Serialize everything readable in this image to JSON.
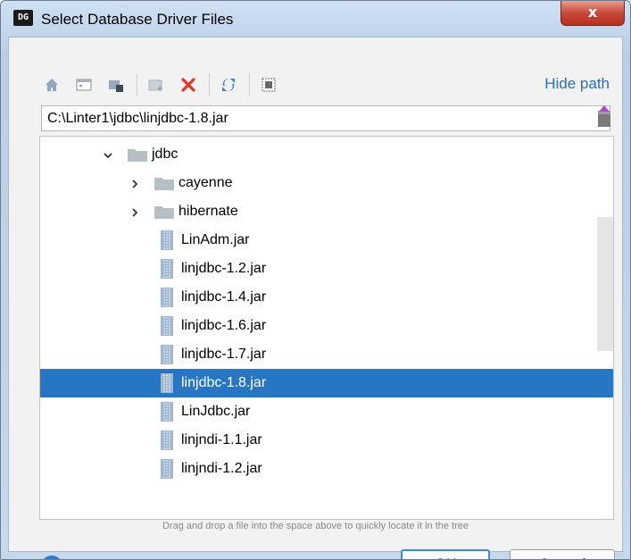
{
  "window": {
    "title": "Select Database Driver Files",
    "app_icon_text": "DG"
  },
  "close_label": "x",
  "toolbar": {
    "icons": [
      "home-icon",
      "desktop-icon",
      "project-icon",
      "new-folder-icon",
      "delete-icon",
      "refresh-icon",
      "show-hidden-icon"
    ],
    "hide_path_label": "Hide path"
  },
  "path": {
    "value": "C:\\Linter1\\jdbc\\linjdbc-1.8.jar"
  },
  "tree": {
    "items": [
      {
        "label": "jdbc",
        "type": "folder",
        "expanded": true,
        "depth": 0
      },
      {
        "label": "cayenne",
        "type": "folder",
        "expanded": false,
        "depth": 1
      },
      {
        "label": "hibernate",
        "type": "folder",
        "expanded": false,
        "depth": 1
      },
      {
        "label": "LinAdm.jar",
        "type": "jar",
        "depth": 1
      },
      {
        "label": "linjdbc-1.2.jar",
        "type": "jar",
        "depth": 1
      },
      {
        "label": "linjdbc-1.4.jar",
        "type": "jar",
        "depth": 1
      },
      {
        "label": "linjdbc-1.6.jar",
        "type": "jar",
        "depth": 1
      },
      {
        "label": "linjdbc-1.7.jar",
        "type": "jar",
        "depth": 1
      },
      {
        "label": "linjdbc-1.8.jar",
        "type": "jar",
        "depth": 1,
        "selected": true
      },
      {
        "label": "LinJdbc.jar",
        "type": "jar",
        "depth": 1
      },
      {
        "label": "linjndi-1.1.jar",
        "type": "jar",
        "depth": 1
      },
      {
        "label": "linjndi-1.2.jar",
        "type": "jar",
        "depth": 1
      }
    ]
  },
  "hint": "Drag and drop a file into the space above to quickly locate it in the tree",
  "help_label": "?",
  "buttons": {
    "ok": "OK",
    "cancel": "Cancel"
  },
  "colors": {
    "selection": "#2676c4",
    "link": "#2d6bb5",
    "delete_x": "#e0362a"
  }
}
